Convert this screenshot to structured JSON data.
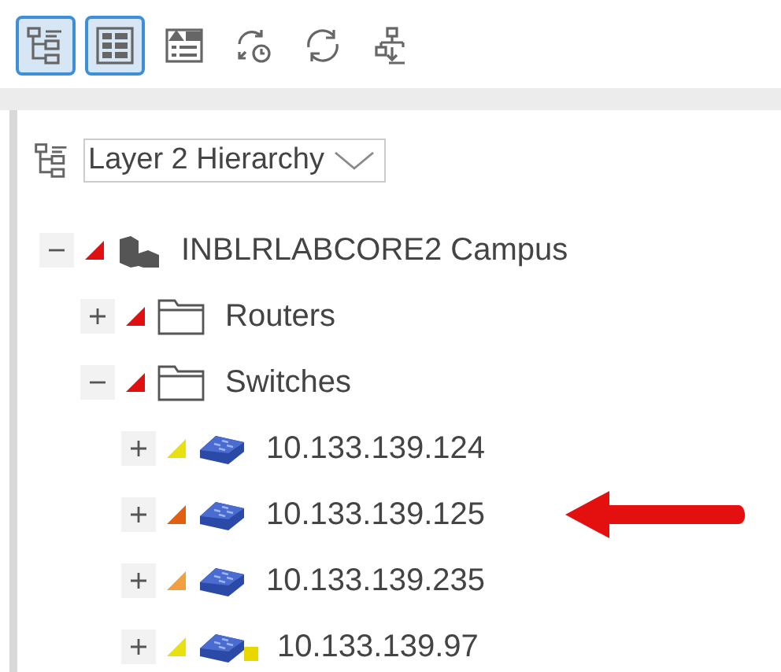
{
  "toolbar": [
    {
      "kind": "tree",
      "selected": true
    },
    {
      "kind": "table",
      "selected": true
    },
    {
      "kind": "details",
      "selected": false
    },
    {
      "kind": "history",
      "selected": false
    },
    {
      "kind": "refresh",
      "selected": false
    },
    {
      "kind": "export",
      "selected": false
    }
  ],
  "view_select": {
    "value": "Layer 2 Hierarchy"
  },
  "tree": [
    {
      "label": "INBLRLABCORE2 Campus",
      "kind": "campus",
      "expanded": true,
      "color": "#e01010",
      "children": [
        {
          "label": "Routers",
          "kind": "folder",
          "expanded": false,
          "color": "#e01010"
        },
        {
          "label": "Switches",
          "kind": "folder",
          "expanded": true,
          "color": "#e01010",
          "children": [
            {
              "label": "10.133.139.124",
              "kind": "switch",
              "expanded": false,
              "color": "#e8e010"
            },
            {
              "label": "10.133.139.125",
              "kind": "switch",
              "expanded": false,
              "color": "#e06010",
              "pointed": true
            },
            {
              "label": "10.133.139.235",
              "kind": "switch",
              "expanded": false,
              "color": "#f0a040"
            },
            {
              "label": "10.133.139.97",
              "kind": "switch",
              "expanded": false,
              "color": "#e8e010",
              "badge": {
                "color": "#e8d800"
              }
            }
          ]
        }
      ]
    }
  ]
}
